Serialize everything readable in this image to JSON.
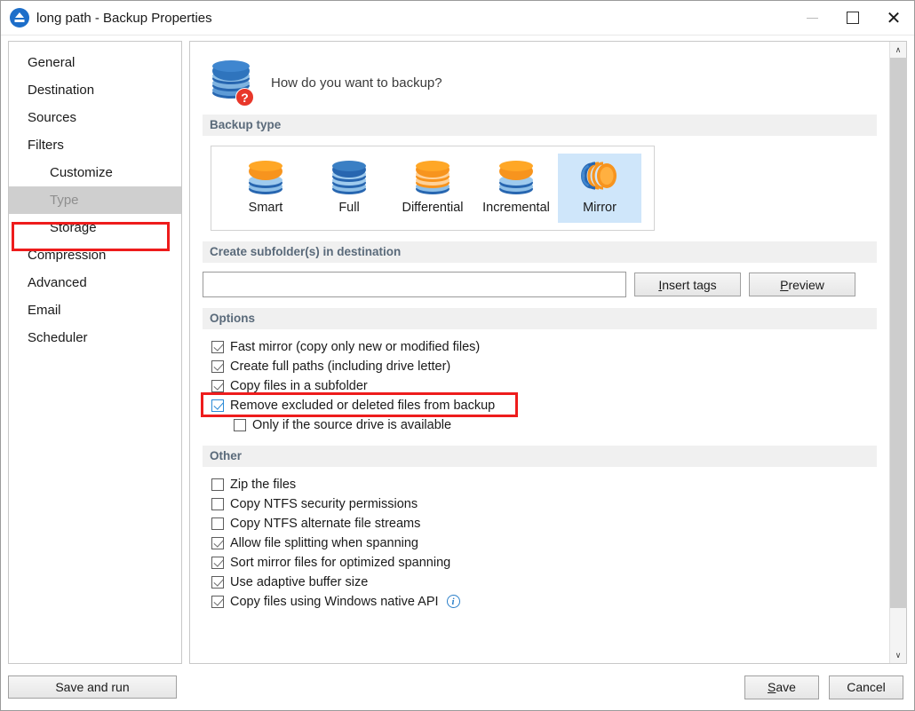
{
  "window": {
    "title": "long path - Backup Properties",
    "app_icon": "eject-circle-icon",
    "controls": {
      "minimize": "—",
      "maximize": "□",
      "close": "✕"
    }
  },
  "sidebar": {
    "items": [
      {
        "label": "General",
        "sub": false,
        "selected": false
      },
      {
        "label": "Destination",
        "sub": false,
        "selected": false
      },
      {
        "label": "Sources",
        "sub": false,
        "selected": false
      },
      {
        "label": "Filters",
        "sub": false,
        "selected": false
      },
      {
        "label": "Customize",
        "sub": true,
        "selected": false
      },
      {
        "label": "Type",
        "sub": true,
        "selected": true
      },
      {
        "label": "Storage",
        "sub": true,
        "selected": false
      },
      {
        "label": "Compression",
        "sub": false,
        "selected": false
      },
      {
        "label": "Advanced",
        "sub": false,
        "selected": false
      },
      {
        "label": "Email",
        "sub": false,
        "selected": false
      },
      {
        "label": "Scheduler",
        "sub": false,
        "selected": false
      }
    ]
  },
  "page": {
    "heading": "How do you want to backup?",
    "heading_icon": "database-question-icon"
  },
  "backup_type": {
    "section_title": "Backup type",
    "tiles": [
      {
        "label": "Smart",
        "icon": "database-orange-blue-icon",
        "selected": false
      },
      {
        "label": "Full",
        "icon": "database-blue-icon",
        "selected": false
      },
      {
        "label": "Differential",
        "icon": "database-orange-icon",
        "selected": false
      },
      {
        "label": "Incremental",
        "icon": "database-orange-blue-icon",
        "selected": false
      },
      {
        "label": "Mirror",
        "icon": "mirror-arcs-icon",
        "selected": true
      }
    ]
  },
  "subfolder": {
    "section_title": "Create subfolder(s) in destination",
    "input_value": "",
    "input_placeholder": "",
    "insert_tags_label": "Insert tags",
    "insert_tags_mnemonic": "I",
    "preview_label": "Preview",
    "preview_mnemonic": "P"
  },
  "options": {
    "section_title": "Options",
    "items": [
      {
        "label": "Fast mirror (copy only new or modified files)",
        "checked": true,
        "indent": false,
        "highlight": false,
        "mnemonic": "m"
      },
      {
        "label": "Create full paths (including drive letter)",
        "checked": true,
        "indent": false,
        "highlight": false,
        "mnemonic": ""
      },
      {
        "label": "Copy files in a subfolder",
        "checked": true,
        "indent": false,
        "highlight": false,
        "mnemonic": "y"
      },
      {
        "label": "Remove excluded or deleted files from backup",
        "checked": true,
        "indent": false,
        "highlight": true,
        "mnemonic": ""
      },
      {
        "label": "Only if the source drive is available",
        "checked": false,
        "indent": true,
        "highlight": false,
        "mnemonic": ""
      }
    ]
  },
  "other": {
    "section_title": "Other",
    "items": [
      {
        "label": "Zip the files",
        "checked": false,
        "info": false
      },
      {
        "label": "Copy NTFS security permissions",
        "checked": false,
        "info": false
      },
      {
        "label": "Copy NTFS alternate file streams",
        "checked": false,
        "info": false
      },
      {
        "label": "Allow file splitting when spanning",
        "checked": true,
        "info": false
      },
      {
        "label": "Sort mirror files for optimized spanning",
        "checked": true,
        "info": false
      },
      {
        "label": "Use adaptive buffer size",
        "checked": true,
        "info": false
      },
      {
        "label": "Copy files using Windows native API",
        "checked": true,
        "info": true
      }
    ]
  },
  "footer": {
    "save_and_run_label": "Save and run",
    "save_label": "Save",
    "save_mnemonic": "S",
    "cancel_label": "Cancel"
  },
  "scrollbar": {
    "up_arrow": "∧",
    "down_arrow": "∨"
  },
  "colors": {
    "accent_blue": "#1d6ec9",
    "selection_blue": "#cfe6fa",
    "annotation_red": "#ee1c1c",
    "db_orange": "#f7941e",
    "db_blue": "#2766b0",
    "section_header_text": "#5a6a7a",
    "nav_selected_bg": "#cfcfcf"
  }
}
